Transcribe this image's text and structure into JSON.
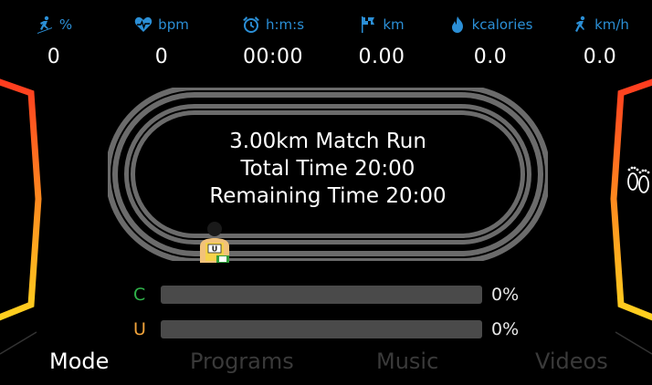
{
  "stats": [
    {
      "icon": "incline-runner-icon",
      "unit": "%",
      "value": "0"
    },
    {
      "icon": "heart-rate-icon",
      "unit": "bpm",
      "value": "0"
    },
    {
      "icon": "alarm-clock-icon",
      "unit": "h:m:s",
      "value": "00:00"
    },
    {
      "icon": "checkered-flag-icon",
      "unit": "km",
      "value": "0.00"
    },
    {
      "icon": "flame-icon",
      "unit": "kcalories",
      "value": "0.0"
    },
    {
      "icon": "runner-speed-icon",
      "unit": "km/h",
      "value": "0.0"
    }
  ],
  "program": {
    "line1": "3.00km Match Run",
    "line2": "Total Time 20:00",
    "line3": "Remaining Time 20:00"
  },
  "progress": [
    {
      "letter": "C",
      "percent_label": "0%",
      "percent": 0,
      "color": "#2fb34a"
    },
    {
      "letter": "U",
      "percent_label": "0%",
      "percent": 0,
      "color": "#f0a23a"
    }
  ],
  "tabs": [
    {
      "label": "Mode",
      "active": true
    },
    {
      "label": "Programs",
      "active": false
    },
    {
      "label": "Music",
      "active": false
    },
    {
      "label": "Videos",
      "active": false
    }
  ],
  "colors": {
    "accent": "#2b8fd6",
    "gauge_top": "#ff3b1f",
    "gauge_bottom": "#ffd21f",
    "track": "#6b6b6b"
  }
}
